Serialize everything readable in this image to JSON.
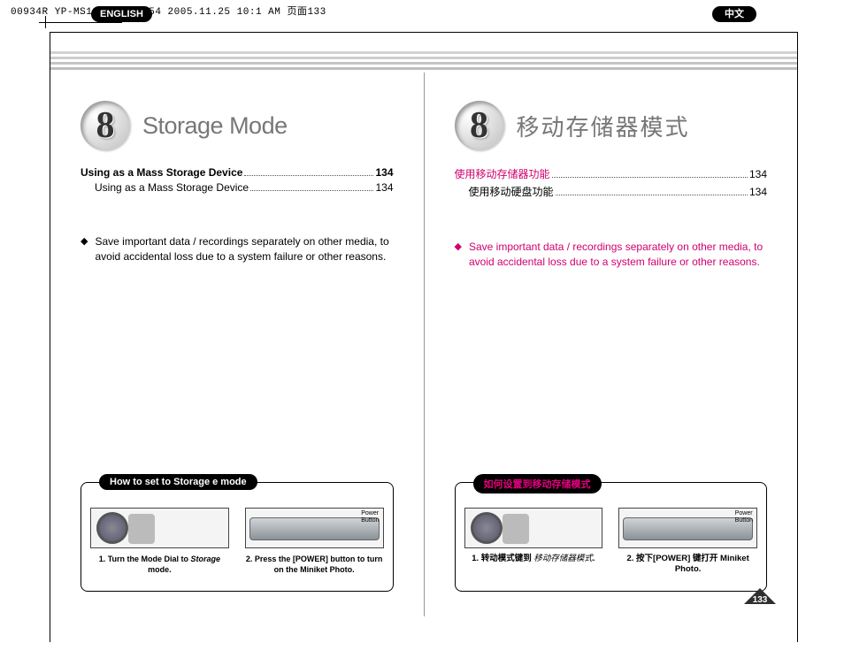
{
  "meta_header": "00934R YP-MS10 UK+CH~154  2005.11.25 10:1 AM  页面133",
  "languages": {
    "left": "ENGLISH",
    "right": "中文"
  },
  "chapter": {
    "number": "8",
    "title_en": "Storage Mode",
    "title_cn": "移动存储器模式"
  },
  "toc_en": {
    "main": {
      "label": "Using as a Mass Storage Device",
      "page": "134"
    },
    "sub": {
      "label": "Using as a Mass Storage Device",
      "page": "134"
    }
  },
  "toc_cn": {
    "main": {
      "label": "使用移动存储器功能",
      "page": "134"
    },
    "sub": {
      "label": "使用移动硬盘功能",
      "page": "134"
    }
  },
  "note_text": "Save important data / recordings separately on other media, to avoid accidental loss due to a system failure or other reasons.",
  "howto": {
    "pill_en": "How to set to Storage e mode",
    "pill_cn": "如何设置到移动存储模式",
    "power_label": "Power\nButton",
    "step1_en": "1. Turn the Mode Dial to Storage mode.",
    "step1_en_prefix": "1. Turn the Mode Dial to ",
    "step1_en_italic": "Storage",
    "step1_en_suffix": " mode.",
    "step2_en": "2. Press the [POWER] button to turn on the Miniket Photo.",
    "step1_cn_prefix": "1. 转动模式键到 ",
    "step1_cn_italic": "移动存储器模式",
    "step1_cn_suffix": ".",
    "step2_cn": "2. 按下[POWER]  键打开 Miniket Photo."
  },
  "page_number": "133"
}
